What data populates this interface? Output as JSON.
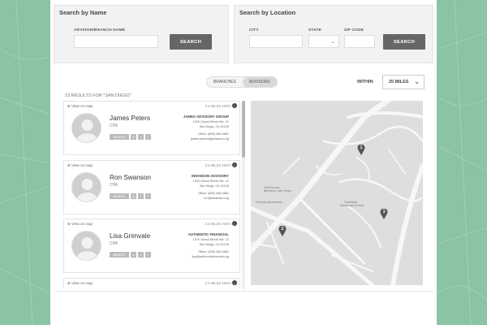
{
  "search_by_name": {
    "title": "Search by Name",
    "field_label": "ADVISOR/BRANCH NAME",
    "field_value": "",
    "button_label": "SEARCH"
  },
  "search_by_location": {
    "title": "Search by Location",
    "city_label": "CITY",
    "city_value": "",
    "state_label": "STATE",
    "state_value": "",
    "zip_label": "ZIP CODE",
    "zip_value": "",
    "button_label": "SEARCH"
  },
  "toggle": {
    "branches": "BRANCHES",
    "advisors": "ADVISORS",
    "selected": "ADVISORS"
  },
  "within": {
    "label": "WITHIN",
    "value": "25 MILES"
  },
  "results": {
    "count_text": "23 RESULTS FOR \"SAN DIEGO\"",
    "cards": [
      {
        "view_map": "View on map",
        "distance": "2.5 MILES AWAY",
        "name": "James Peters",
        "title": "CPA",
        "website": "WEBSITE",
        "firm": "JAMES ADVISORY GROUP",
        "addr1": "1320 Grand Street Ste. 47",
        "addr2": "San Diego, Ca 92126",
        "phone": "Office: (858) 408-4861",
        "email": "james.peters@jadvisors.org"
      },
      {
        "view_map": "View on map",
        "distance": "2.5 MILES AWAY",
        "name": "Ron Swanson",
        "title": "CPA",
        "website": "WEBSITE",
        "firm": "SWANSON ADVISORY",
        "addr1": "1320 Grand Street Ste. 47",
        "addr2": "San Diego, Ca 92126",
        "phone": "Office: (858) 408-4861",
        "email": "ron@swanson.org"
      },
      {
        "view_map": "View on map",
        "distance": "2.5 MILES AWAY",
        "name": "Lisa Grimvale",
        "title": "CPA",
        "website": "WEBSITE",
        "firm": "AUTHENTIC FINANCIAL",
        "addr1": "1370 Grand Street Ste. 47",
        "addr2": "San Diego, Ca 92126",
        "phone": "Office: (408) 408-4861",
        "email": "lisa@authenticfinancial.org"
      },
      {
        "view_map": "View on map",
        "distance": "2.5 MILES AWAY",
        "name": "",
        "title": "",
        "website": "",
        "firm": "",
        "addr1": "",
        "addr2": "",
        "phone": "",
        "email": ""
      }
    ]
  },
  "map": {
    "pins": [
      {
        "label": "1"
      },
      {
        "label": "2"
      },
      {
        "label": "3"
      }
    ],
    "place_labels": [
      "Villa Rancho Bernardo Care Center",
      "Parkview Apartments",
      "Turtleback Elementary School"
    ]
  },
  "colors": {
    "background": "#8bc3a5",
    "button": "#666666",
    "pin": "#555555"
  },
  "icons": {
    "map_pin": "map-pin-icon",
    "info": "info-icon",
    "linkedin": "linkedin-icon",
    "twitter": "twitter-icon",
    "facebook": "facebook-icon",
    "chevron": "chevron-down-icon"
  }
}
